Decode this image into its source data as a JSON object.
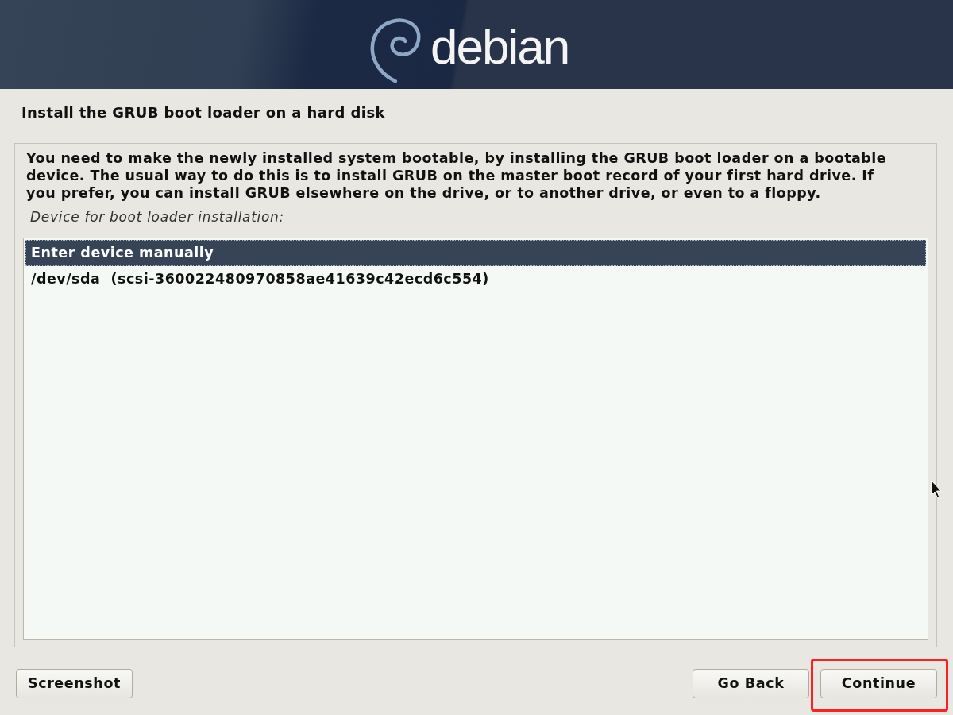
{
  "header": {
    "logo_text": "debian"
  },
  "title": "Install the GRUB boot loader on a hard disk",
  "description": "You need to make the newly installed system bootable, by installing the GRUB boot loader on a bootable device. The usual way to do this is to install GRUB on the master boot record of your first hard drive. If you prefer, you can install GRUB elsewhere on the drive, or to another drive, or even to a floppy.",
  "prompt": "Device for boot loader installation:",
  "devices": [
    {
      "label": "Enter device manually",
      "selected": true
    },
    {
      "label": "/dev/sda  (scsi-360022480970858ae41639c42ecd6c554)",
      "selected": false
    }
  ],
  "footer": {
    "left_buttons": [
      {
        "label": "Screenshot",
        "highlighted": false
      }
    ],
    "right_buttons": [
      {
        "label": "Go Back",
        "highlighted": false
      },
      {
        "label": "Continue",
        "highlighted": true
      }
    ]
  }
}
